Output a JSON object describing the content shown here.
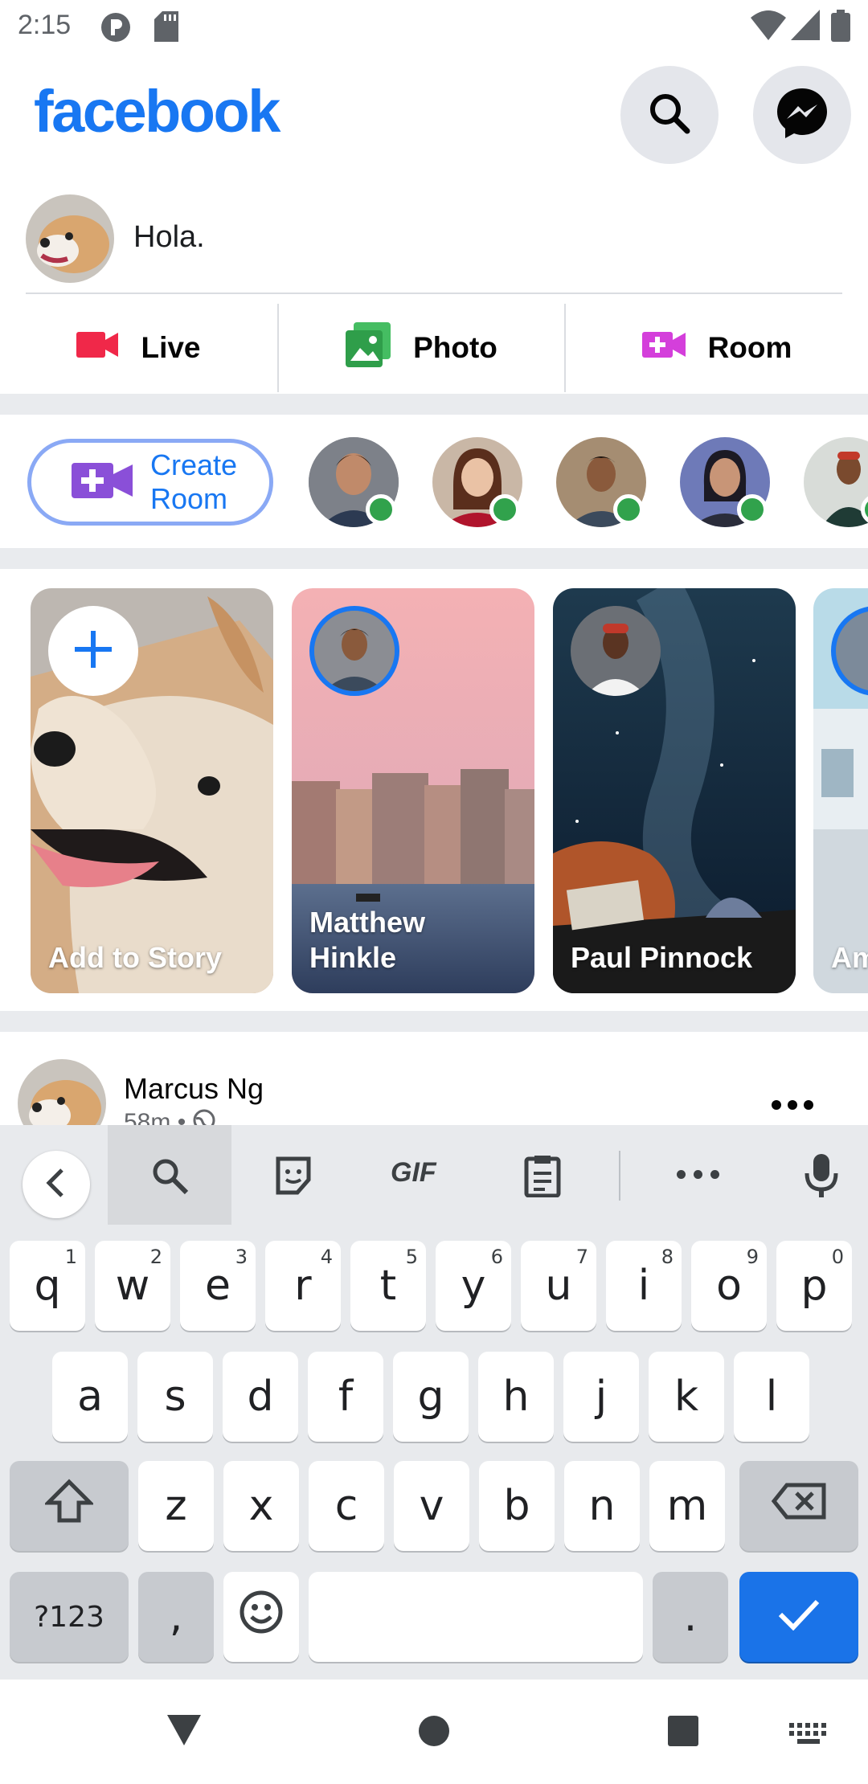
{
  "status_bar": {
    "time": "2:15"
  },
  "header": {
    "logo": "facebook",
    "search_icon": "search-icon",
    "messenger_icon": "messenger-icon"
  },
  "composer": {
    "placeholder": "Hola."
  },
  "actions": [
    {
      "label": "Live",
      "color": "#f02849"
    },
    {
      "label": "Photo",
      "color": "#45bd62"
    },
    {
      "label": "Room",
      "color": "#d43fdb"
    }
  ],
  "rooms": {
    "create_line1": "Create",
    "create_line2": "Room"
  },
  "stories": [
    {
      "name": "Add to Story"
    },
    {
      "name_line1": "Matthew",
      "name_line2": "Hinkle"
    },
    {
      "name": "Paul Pinnock"
    },
    {
      "name": "Am"
    }
  ],
  "post": {
    "author": "Marcus Ng",
    "meta": "58m • "
  },
  "keyboard": {
    "row1": [
      {
        "k": "q",
        "s": "1"
      },
      {
        "k": "w",
        "s": "2"
      },
      {
        "k": "e",
        "s": "3"
      },
      {
        "k": "r",
        "s": "4"
      },
      {
        "k": "t",
        "s": "5"
      },
      {
        "k": "y",
        "s": "6"
      },
      {
        "k": "u",
        "s": "7"
      },
      {
        "k": "i",
        "s": "8"
      },
      {
        "k": "o",
        "s": "9"
      },
      {
        "k": "p",
        "s": "0"
      }
    ],
    "row2": [
      "a",
      "s",
      "d",
      "f",
      "g",
      "h",
      "j",
      "k",
      "l"
    ],
    "row3": [
      "z",
      "x",
      "c",
      "v",
      "b",
      "n",
      "m"
    ],
    "symbols": "?123",
    "comma": ",",
    "period": ".",
    "gif": "GIF"
  },
  "colors": {
    "accent": "#1877f2",
    "online": "#31a24c",
    "keyboard_bg": "#e8eaed",
    "enter_key": "#1a73e8"
  }
}
